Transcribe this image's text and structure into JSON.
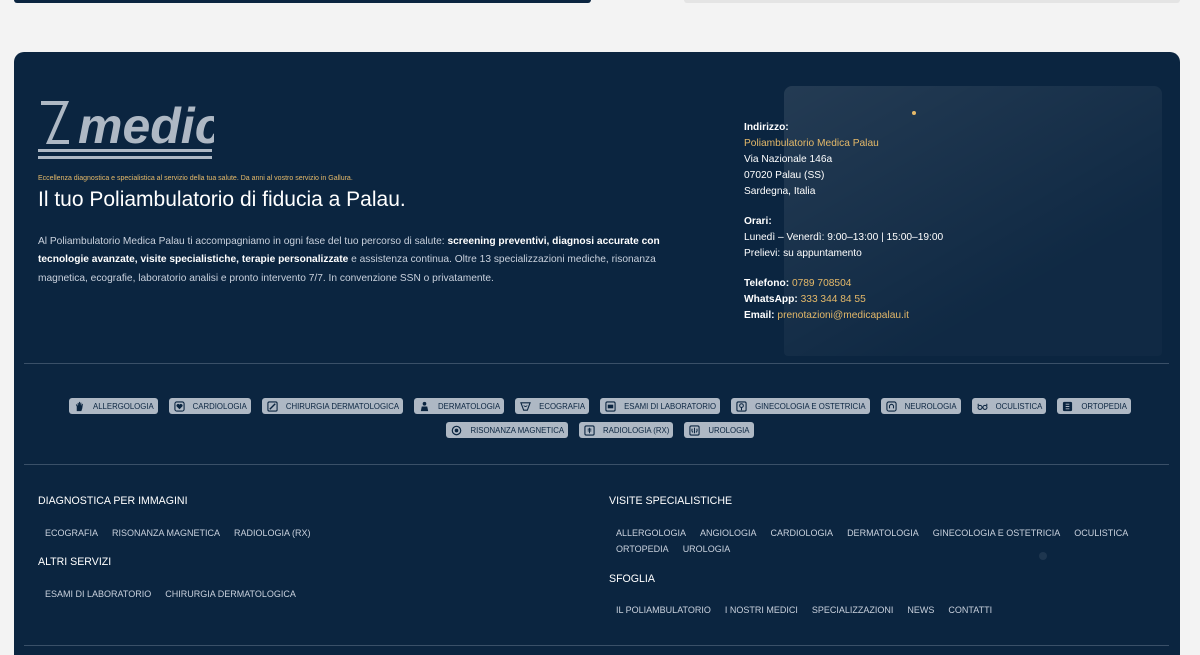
{
  "brand": {
    "logo_text": "medica",
    "tagline": "Eccellenza diagnostica e specialistica al servizio della tua salute. Da anni al vostro servizio in Gallura.",
    "headline": "Il tuo Poliambulatorio di fiducia a Palau."
  },
  "intro": {
    "p1": "Al Poliambulatorio Medica Palau ti accompagniamo in ogni fase del tuo percorso di salute: ",
    "b1": "screening preventivi, diagnosi accurate con tecnologie avanzate, visite specialistiche, terapie personalizzate",
    "p2": " e assistenza continua. Oltre 13 specializzazioni mediche, risonanza magnetica, ecografie, laboratorio analisi e pronto intervento 7/7. In convenzione SSN o privatamente."
  },
  "contact": {
    "address_label": "Indirizzo:",
    "name": "Poliambulatorio Medica Palau",
    "street": "Via Nazionale 146a",
    "city": "07020 Palau (SS)",
    "region": "Sardegna, Italia",
    "hours_label": "Orari:",
    "hours": "Lunedì – Venerdì: 9:00–13:00 | 15:00–19:00",
    "samples": "Prelievi: su appuntamento",
    "phone_label": "Telefono:",
    "phone": "0789 708504",
    "whatsapp_label": "WhatsApp:",
    "whatsapp": "333 344 84 55",
    "email_label": "Email:",
    "email": "prenotazioni@medicapalau.it"
  },
  "specialties": [
    {
      "label": "ALLERGOLOGIA",
      "icon": "hand-icon"
    },
    {
      "label": "CARDIOLOGIA",
      "icon": "heart-icon"
    },
    {
      "label": "CHIRURGIA DERMATOLOGICA",
      "icon": "scalpel-icon"
    },
    {
      "label": "DERMATOLOGIA",
      "icon": "skin-icon"
    },
    {
      "label": "ECOGRAFIA",
      "icon": "ultrasound-icon"
    },
    {
      "label": "ESAMI DI LABORATORIO",
      "icon": "lab-icon"
    },
    {
      "label": "GINECOLOGIA E OSTETRICIA",
      "icon": "gynecology-icon"
    },
    {
      "label": "NEUROLOGIA",
      "icon": "brain-icon"
    },
    {
      "label": "OCULISTICA",
      "icon": "glasses-icon"
    },
    {
      "label": "ORTOPEDIA",
      "icon": "bone-icon"
    },
    {
      "label": "RISONANZA MAGNETICA",
      "icon": "mri-icon"
    },
    {
      "label": "RADIOLOGIA (RX)",
      "icon": "xray-icon"
    },
    {
      "label": "UROLOGIA",
      "icon": "kidney-icon"
    }
  ],
  "footer_nav": {
    "diagnostica": {
      "title": "DIAGNOSTICA PER IMMAGINI",
      "links": [
        "ECOGRAFIA",
        "RISONANZA MAGNETICA",
        "RADIOLOGIA (RX)"
      ]
    },
    "altri": {
      "title": "ALTRI SERVIZI",
      "links": [
        "ESAMI DI LABORATORIO",
        "CHIRURGIA DERMATOLOGICA"
      ]
    },
    "visite": {
      "title": "VISITE SPECIALISTICHE",
      "links": [
        "ALLERGOLOGIA",
        "ANGIOLOGIA",
        "CARDIOLOGIA",
        "DERMATOLOGIA",
        "GINECOLOGIA E OSTETRICIA",
        "OCULISTICA",
        "ORTOPEDIA",
        "UROLOGIA"
      ]
    },
    "sfoglia": {
      "title": "SFOGLIA",
      "links": [
        "IL POLIAMBULATORIO",
        "I NOSTRI MEDICI",
        "SPECIALIZZAZIONI",
        "NEWS",
        "CONTATTI"
      ]
    }
  },
  "colors": {
    "background": "#0b2540",
    "accent": "#e5b969",
    "chip": "#aeb8c4"
  }
}
